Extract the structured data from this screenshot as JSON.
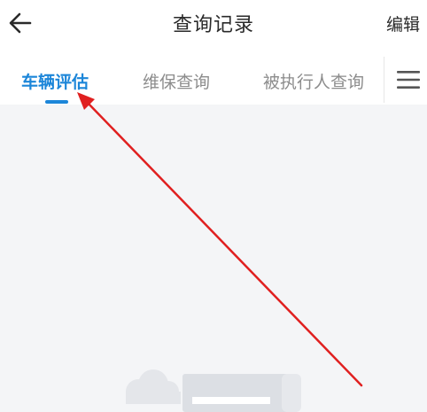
{
  "header": {
    "title": "查询记录",
    "edit_label": "编辑",
    "back_icon": "arrow-left-icon"
  },
  "tabs": [
    {
      "label": "车辆评估",
      "active": true
    },
    {
      "label": "维保查询",
      "active": false
    },
    {
      "label": "被执行人查询",
      "active": false
    }
  ],
  "menu_icon": "hamburger-menu-icon",
  "colors": {
    "accent": "#1c86d9",
    "annotation_arrow": "#e02020",
    "content_background": "#f4f5f7"
  }
}
